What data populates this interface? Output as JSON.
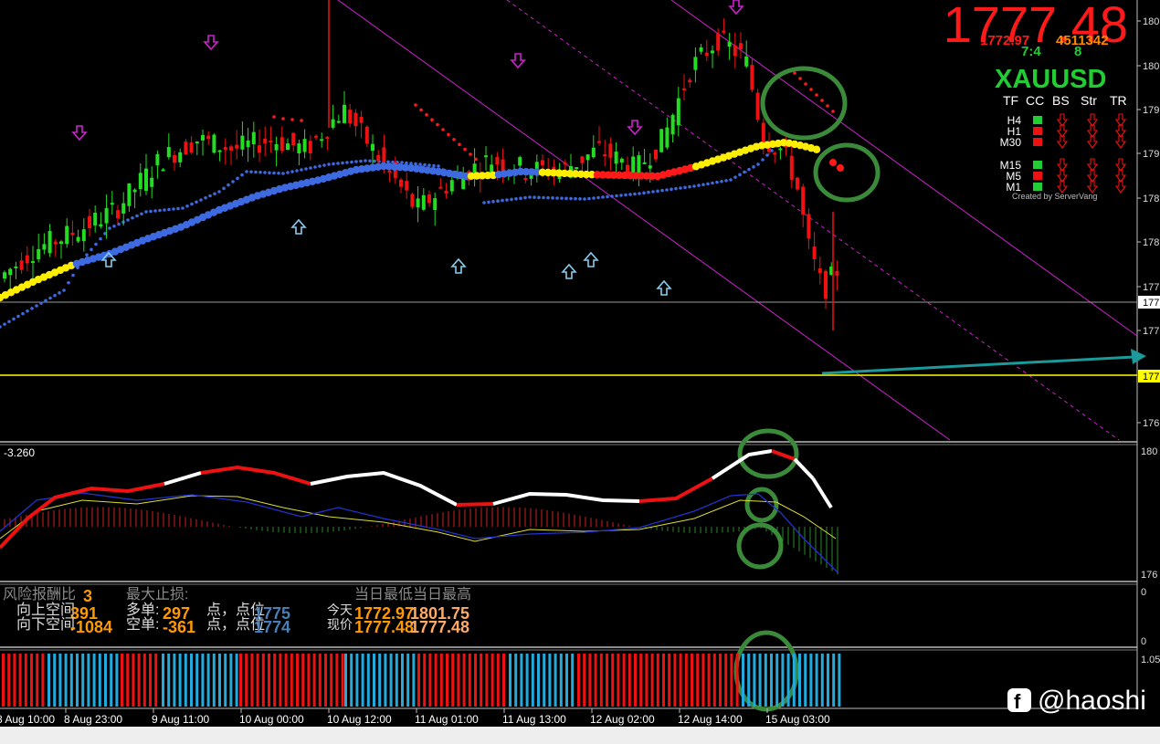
{
  "symbol": "XAUUSD",
  "header": {
    "big_price": "1777.48",
    "sub_price_left": "1772.97",
    "sub_price_right": "4511342",
    "ratio": "7:4",
    "count": "8",
    "tf_headers": [
      "TF",
      "CC",
      "BS",
      "Str",
      "TR"
    ],
    "credit": "Created by ServerVang",
    "colors": {
      "big_price": "#ff1a1a",
      "symbol": "#22cc33"
    }
  },
  "tf_table": [
    {
      "tf": "H4",
      "cc": "green",
      "signals": [
        "down",
        "down",
        "down"
      ]
    },
    {
      "tf": "H1",
      "cc": "red",
      "signals": [
        "down",
        "down",
        "down"
      ]
    },
    {
      "tf": "M30",
      "cc": "red",
      "signals": [
        "down",
        "down",
        "down"
      ]
    },
    {
      "tf": "M15",
      "cc": "green",
      "signals": [
        "down",
        "down",
        "down"
      ]
    },
    {
      "tf": "M5",
      "cc": "red",
      "signals": [
        "down",
        "down",
        "down"
      ]
    },
    {
      "tf": "M1",
      "cc": "green",
      "signals": [
        "down",
        "down",
        "down"
      ]
    }
  ],
  "price_axis": {
    "labels": [
      "180",
      "180",
      "179",
      "179",
      "178",
      "178",
      "177",
      "177",
      "177",
      "177",
      "176"
    ],
    "current_tag": "177",
    "support_tag": "177"
  },
  "macd_panel": {
    "value_label": "-3.260",
    "axis_labels": [
      "180",
      "176"
    ]
  },
  "info_panel": {
    "axis_labels": [
      "0",
      "0"
    ],
    "risk_reward_label": "风险报酬比",
    "risk_reward_value": "3",
    "max_stop_label": "最大止损:",
    "low_high_header": "当日最低当日最高",
    "up_space_label": "向上空间",
    "up_space_value": "391",
    "down_space_label": "向下空间",
    "down_space_value": "-1084",
    "long_label": "多单:",
    "long_value": "297",
    "short_label": "空单:",
    "short_value": "-361",
    "points_text": "点，点位",
    "long_price": "1775",
    "short_price": "1774",
    "today_label": "今天",
    "now_label": "现价",
    "today_low": "1772.97",
    "today_high": "1801.75",
    "now_low": "1777.48",
    "now_high": "1777.48"
  },
  "histogram_panel": {
    "axis_label": "1.05"
  },
  "time_axis": [
    "8 Aug 10:00",
    "8 Aug 23:00",
    "9 Aug 11:00",
    "10 Aug 00:00",
    "10 Aug 12:00",
    "11 Aug 01:00",
    "11 Aug 13:00",
    "12 Aug 02:00",
    "12 Aug 14:00",
    "15 Aug 03:00"
  ],
  "watermark": "@haoshi",
  "chart_data": {
    "type": "candlestick",
    "symbol": "XAUUSD",
    "x": [
      "8 Aug 10:00",
      "8 Aug 23:00",
      "9 Aug 11:00",
      "10 Aug 00:00",
      "10 Aug 12:00",
      "11 Aug 01:00",
      "11 Aug 13:00",
      "12 Aug 02:00",
      "12 Aug 14:00",
      "15 Aug 03:00"
    ],
    "close_trend": [
      1775.9,
      1778.6,
      1787.4,
      1789.5,
      1788.8,
      1786.3,
      1787.2,
      1789.4,
      1796.8,
      1778.8
    ],
    "last_price": 1777.48,
    "today_low": 1772.97,
    "today_high": 1801.75,
    "colors": {
      "up": "#22dd22",
      "down": "#ee1111",
      "ma_yellow": "#ffee00",
      "ma_red": "#ff1a1a",
      "ma_blue": "#3d6ae0",
      "channel": "#cc22cc"
    }
  }
}
